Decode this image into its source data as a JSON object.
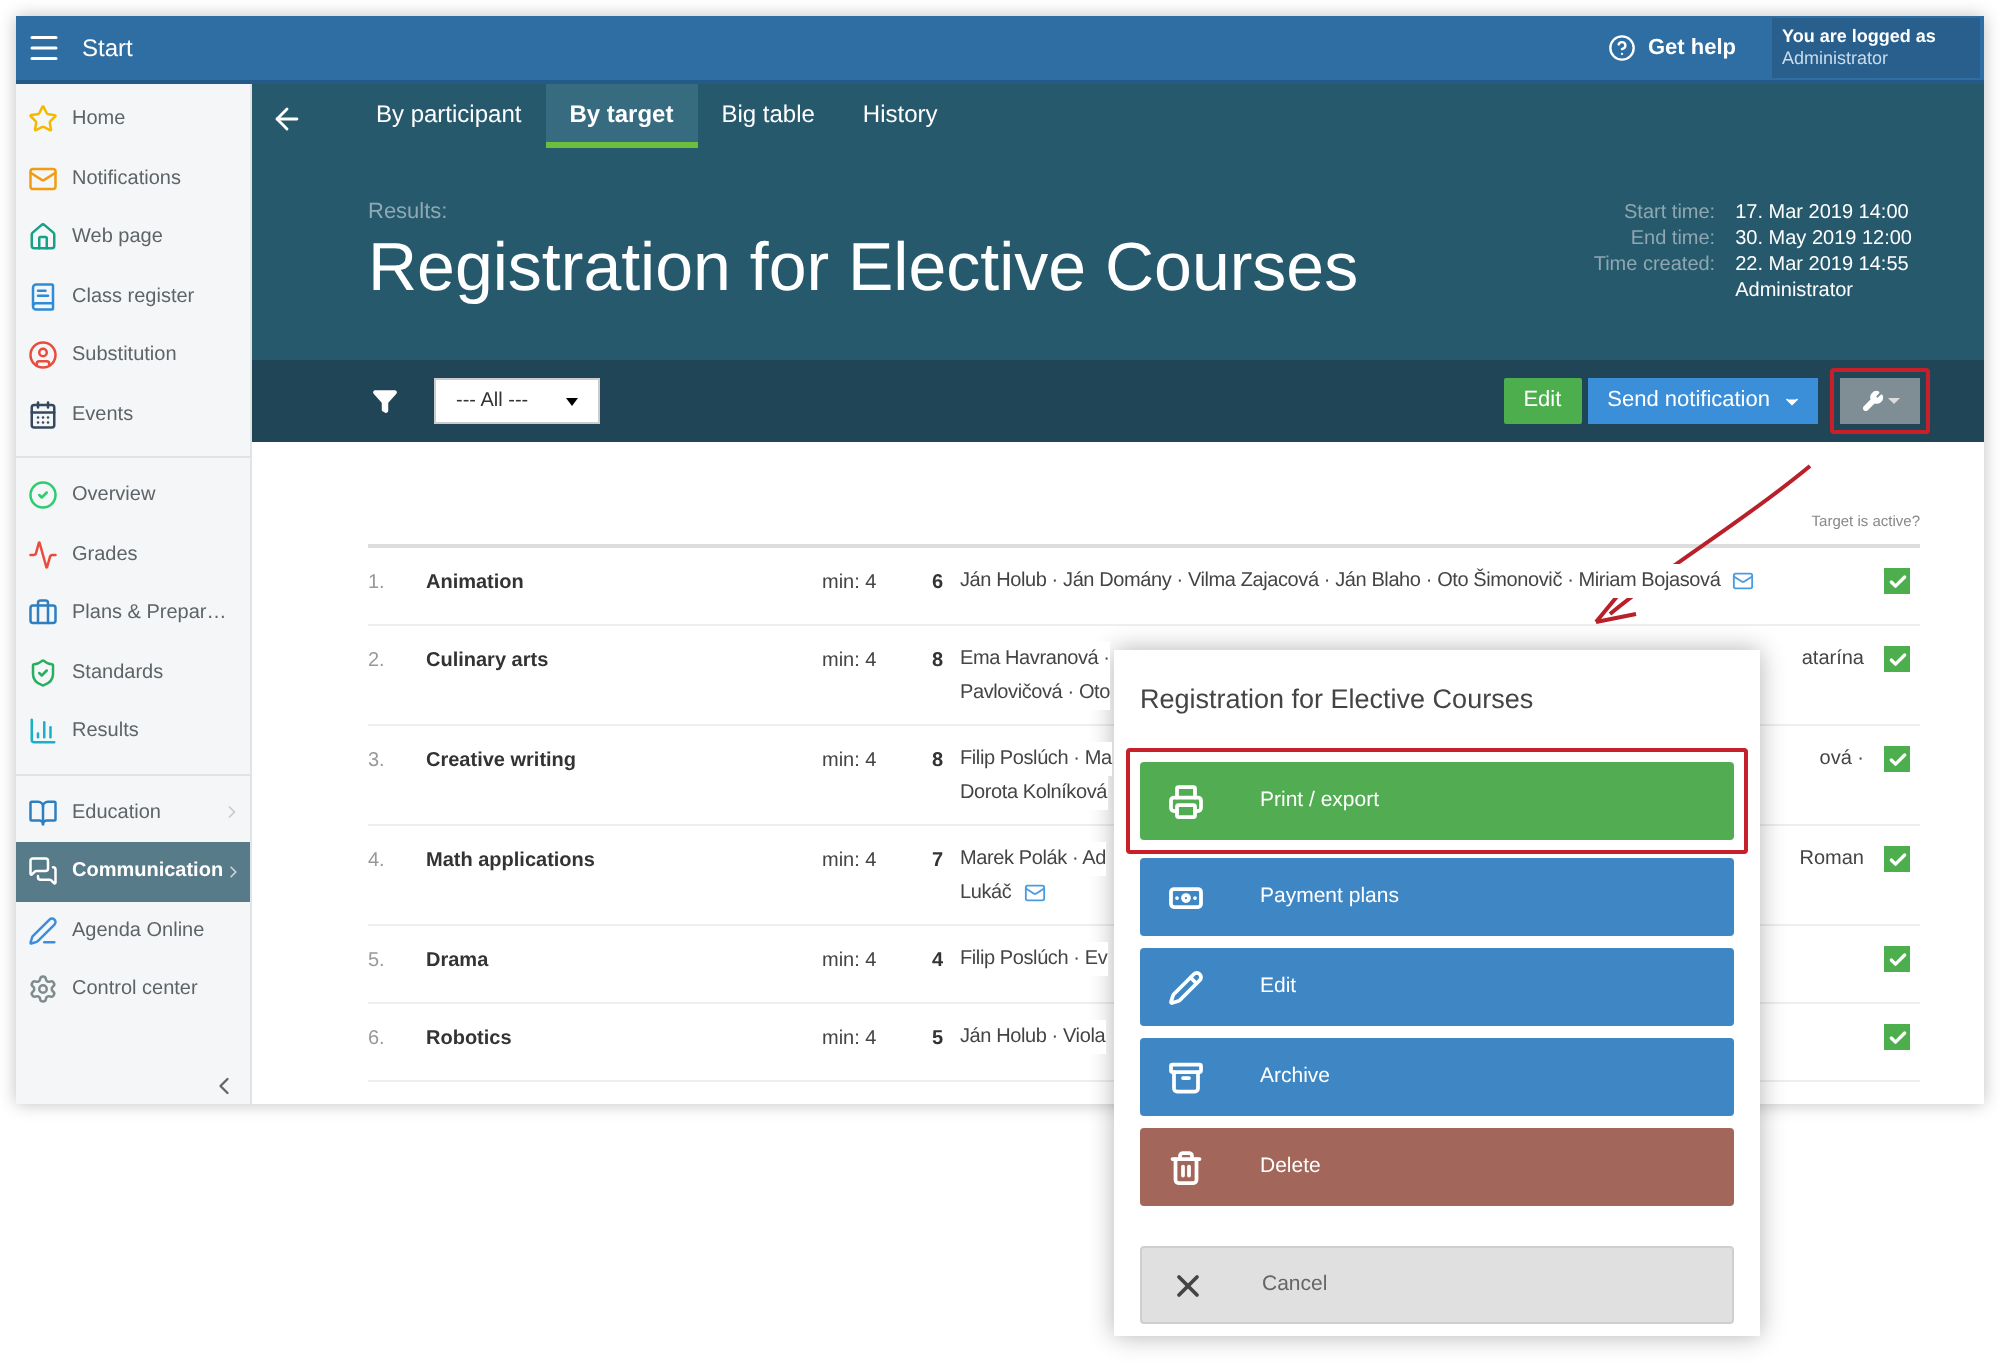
{
  "topbar": {
    "title": "Start",
    "help": "Get help",
    "login_label": "You are logged as",
    "login_user": "Administrator"
  },
  "sidebar": {
    "groups": [
      {
        "items": [
          {
            "label": "Home",
            "selected": false,
            "expandable": false
          },
          {
            "label": "Notifications",
            "selected": false,
            "expandable": false
          },
          {
            "label": "Web page",
            "selected": false,
            "expandable": false
          },
          {
            "label": "Class register",
            "selected": false,
            "expandable": false
          },
          {
            "label": "Substitution",
            "selected": false,
            "expandable": false
          },
          {
            "label": "Events",
            "selected": false,
            "expandable": false
          }
        ]
      },
      {
        "items": [
          {
            "label": "Overview",
            "selected": false,
            "expandable": false
          },
          {
            "label": "Grades",
            "selected": false,
            "expandable": false
          },
          {
            "label": "Plans & Prepar…",
            "selected": false,
            "expandable": false
          },
          {
            "label": "Standards",
            "selected": false,
            "expandable": false
          },
          {
            "label": "Results",
            "selected": false,
            "expandable": false
          }
        ]
      },
      {
        "items": [
          {
            "label": "Education",
            "selected": false,
            "expandable": true
          },
          {
            "label": "Communication",
            "selected": true,
            "expandable": true
          },
          {
            "label": "Agenda Online",
            "selected": false,
            "expandable": false
          },
          {
            "label": "Control center",
            "selected": false,
            "expandable": false
          }
        ]
      }
    ]
  },
  "tabs": [
    {
      "label": "By participant",
      "selected": false
    },
    {
      "label": "By target",
      "selected": true
    },
    {
      "label": "Big table",
      "selected": false
    },
    {
      "label": "History",
      "selected": false
    }
  ],
  "header": {
    "subtitle": "Results:",
    "title": "Registration for Elective Courses",
    "info": [
      {
        "label": "Start time:",
        "value": "17. Mar 2019 14:00"
      },
      {
        "label": "End time:",
        "value": "30. May 2019 12:00"
      },
      {
        "label": "Time created:",
        "value": "22. Mar 2019 14:55",
        "extra": "Administrator"
      }
    ]
  },
  "toolbar": {
    "filter": {
      "value": "--- All ---"
    },
    "edit": "Edit",
    "send": "Send notification",
    "tools_highlighted": true
  },
  "table": {
    "active_header": "Target is active?",
    "rows": [
      {
        "index": "1.",
        "name": "Animation",
        "min": "min: 4",
        "count": "6",
        "lines": [
          {
            "left": "Ján Holub · Ján Domány · Vilma Zajacová · Ján Blaho · Oto Šimonovič · Miriam Bojasová"
          }
        ],
        "mail": true,
        "checked": true
      },
      {
        "index": "2.",
        "name": "Culinary arts",
        "min": "min: 4",
        "count": "8",
        "lines": [
          {
            "left": "Ema Havranová ·",
            "right": "atarína"
          },
          {
            "left": "Pavlovičová · Oto"
          }
        ],
        "mail": false,
        "checked": true
      },
      {
        "index": "3.",
        "name": "Creative writing",
        "min": "min: 4",
        "count": "8",
        "lines": [
          {
            "left": "Filip Poslúch · Ma",
            "right": "ová ·"
          },
          {
            "left": "Dorota Kolníková"
          }
        ],
        "mail": false,
        "checked": true
      },
      {
        "index": "4.",
        "name": "Math applications",
        "min": "min: 4",
        "count": "7",
        "lines": [
          {
            "left": "Marek Polák · Ad",
            "right": "Roman"
          },
          {
            "left": "Lukáč"
          }
        ],
        "mail": true,
        "checked": true
      },
      {
        "index": "5.",
        "name": "Drama",
        "min": "min: 4",
        "count": "4",
        "lines": [
          {
            "left": "Filip Poslúch · Ev"
          }
        ],
        "mail": false,
        "checked": true
      },
      {
        "index": "6.",
        "name": "Robotics",
        "min": "min: 4",
        "count": "5",
        "lines": [
          {
            "left": "Ján Holub · Viola"
          }
        ],
        "mail": false,
        "checked": true
      }
    ]
  },
  "dialog": {
    "title": "Registration for Elective Courses",
    "actions": [
      {
        "label": "Print / export",
        "kind": "success",
        "highlighted": true
      },
      {
        "label": "Payment plans",
        "kind": "primary",
        "highlighted": false
      },
      {
        "label": "Edit",
        "kind": "primary",
        "highlighted": false
      },
      {
        "label": "Archive",
        "kind": "primary",
        "highlighted": false
      },
      {
        "label": "Delete",
        "kind": "danger",
        "highlighted": false
      },
      {
        "label": "Cancel",
        "kind": "cancel",
        "highlighted": false
      }
    ]
  }
}
